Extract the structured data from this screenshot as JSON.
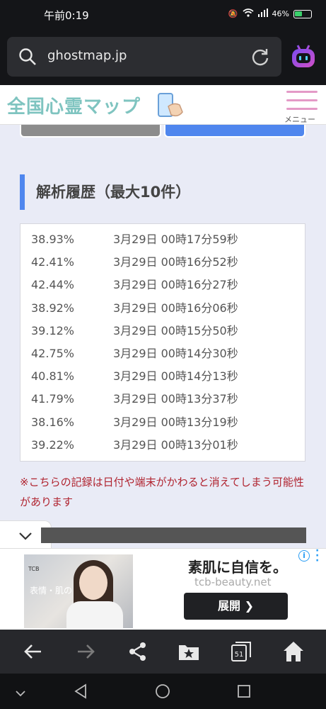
{
  "status_bar": {
    "time": "午前0:19",
    "battery": "46%"
  },
  "url_bar": {
    "url": "ghostmap.jp"
  },
  "site_header": {
    "logo_text": "全国心霊マップ",
    "menu_label": "メニュー"
  },
  "history": {
    "title": "解析履歴（最大10件）",
    "rows": [
      {
        "percent": "38.93%",
        "datetime": "3月29日 00時17分59秒"
      },
      {
        "percent": "42.41%",
        "datetime": "3月29日 00時16分52秒"
      },
      {
        "percent": "42.44%",
        "datetime": "3月29日 00時16分27秒"
      },
      {
        "percent": "38.92%",
        "datetime": "3月29日 00時16分06秒"
      },
      {
        "percent": "39.12%",
        "datetime": "3月29日 00時15分50秒"
      },
      {
        "percent": "42.75%",
        "datetime": "3月29日 00時14分30秒"
      },
      {
        "percent": "40.81%",
        "datetime": "3月29日 00時14分13秒"
      },
      {
        "percent": "41.79%",
        "datetime": "3月29日 00時13分37秒"
      },
      {
        "percent": "38.16%",
        "datetime": "3月29日 00時13分19秒"
      },
      {
        "percent": "39.22%",
        "datetime": "3月29日 00時13分01秒"
      }
    ],
    "note": "※こちらの記録は日付や端末がかわると消えてしまう可能性があります"
  },
  "ad": {
    "brand": "TCB",
    "image_copy": "表情・肌の",
    "title": "素肌に自信を。",
    "url": "tcb-beauty.net",
    "button_label": "展開 ❯"
  },
  "browser_bar": {
    "tab_count": "51"
  },
  "colors": {
    "accent_blue": "#4f86ee",
    "note_red": "#b0232f",
    "menu_pink": "#e49ac7"
  }
}
